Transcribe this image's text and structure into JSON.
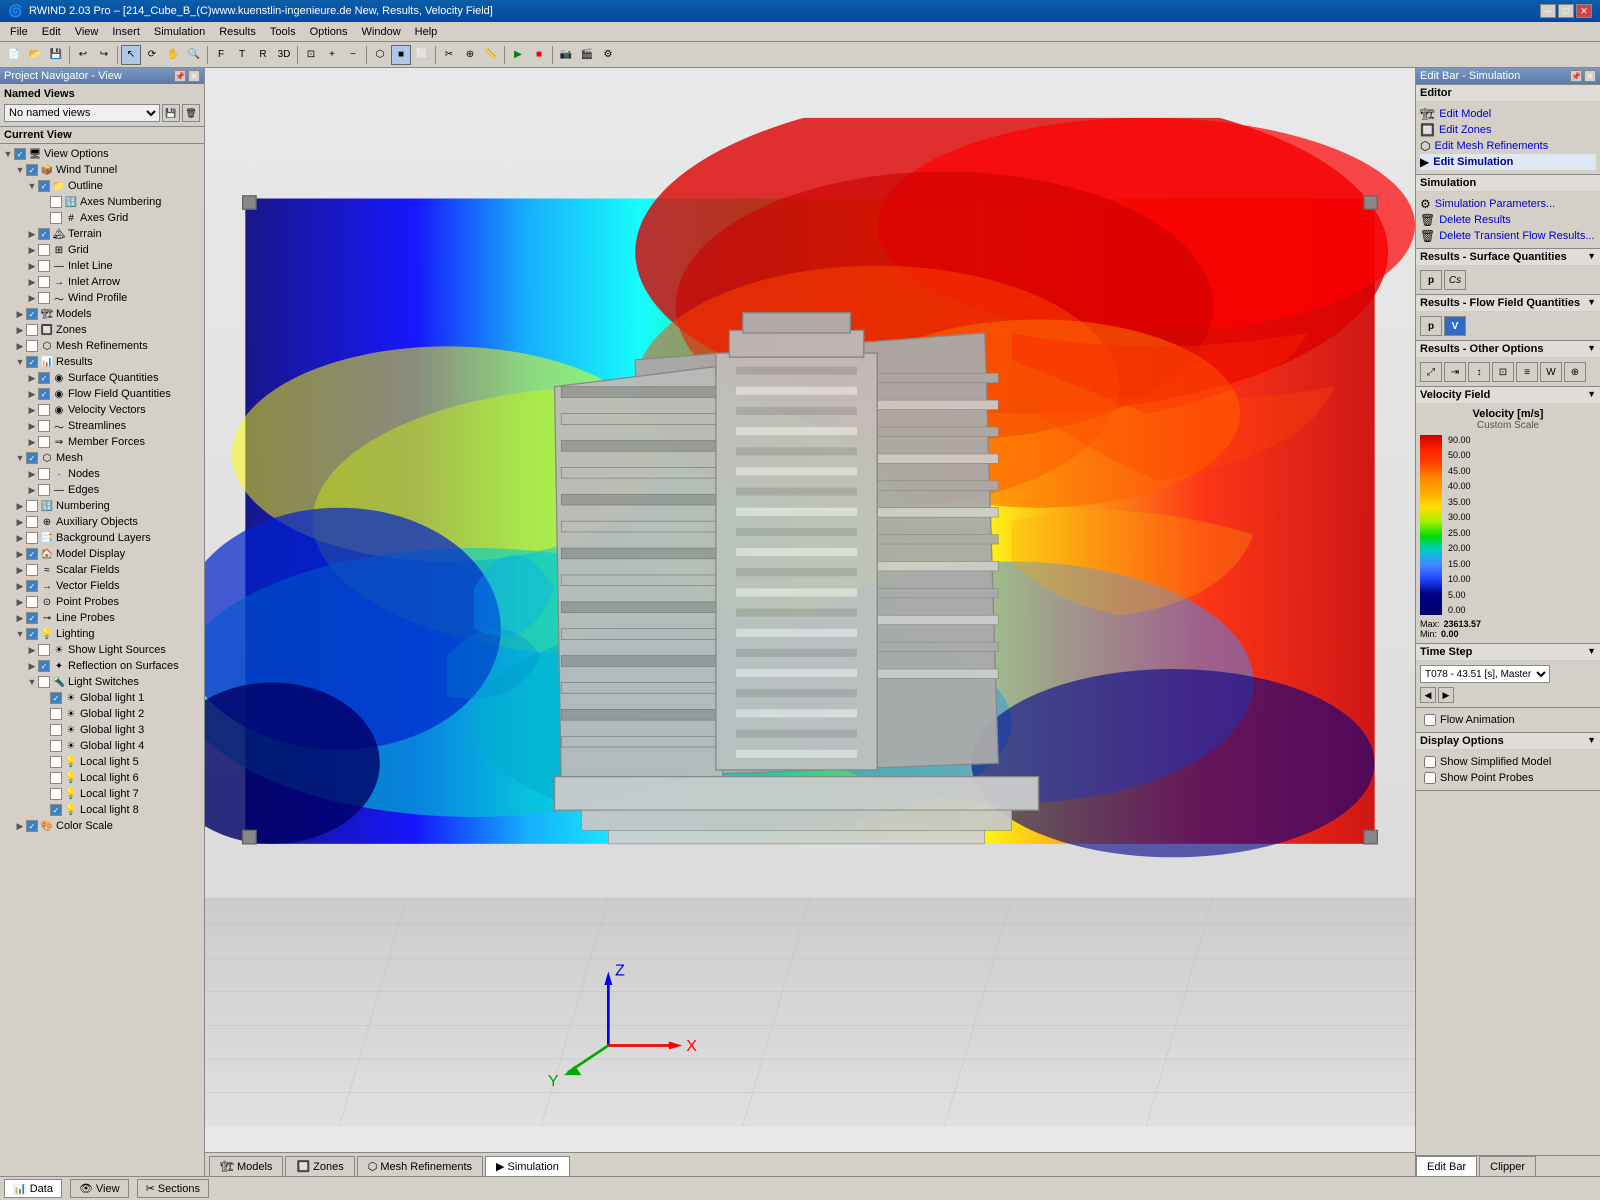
{
  "window": {
    "title": "RWIND 2.03 Pro – [214_Cube_B_(C)www.kuenstlin-ingenieure.de New, Results, Velocity Field]",
    "icon": "🌀"
  },
  "menu": {
    "items": [
      "File",
      "Edit",
      "View",
      "Insert",
      "Simulation",
      "Results",
      "Tools",
      "Options",
      "Window",
      "Help"
    ]
  },
  "left_panel": {
    "title": "Project Navigator - View",
    "named_views_label": "Named Views",
    "named_views_placeholder": "No named views",
    "current_view_label": "Current View",
    "tree": [
      {
        "id": "view-options",
        "label": "View Options",
        "level": 0,
        "expand": true,
        "checked": true,
        "icon": "🖥"
      },
      {
        "id": "wind-tunnel",
        "label": "Wind Tunnel",
        "level": 1,
        "expand": true,
        "checked": true,
        "icon": "📦"
      },
      {
        "id": "outline",
        "label": "Outline",
        "level": 2,
        "expand": true,
        "checked": true,
        "icon": "📁"
      },
      {
        "id": "axes-numbering",
        "label": "Axes Numbering",
        "level": 3,
        "checked": false,
        "icon": "🔢"
      },
      {
        "id": "axes-grid",
        "label": "Axes Grid",
        "level": 3,
        "checked": false,
        "icon": "#"
      },
      {
        "id": "terrain",
        "label": "Terrain",
        "level": 2,
        "checked": true,
        "icon": "🏔"
      },
      {
        "id": "grid",
        "label": "Grid",
        "level": 2,
        "checked": false,
        "icon": "⊞"
      },
      {
        "id": "inlet-line",
        "label": "Inlet Line",
        "level": 2,
        "checked": false,
        "icon": "—"
      },
      {
        "id": "inlet-arrow",
        "label": "Inlet Arrow",
        "level": 2,
        "checked": false,
        "icon": "→"
      },
      {
        "id": "wind-profile",
        "label": "Wind Profile",
        "level": 2,
        "checked": false,
        "icon": "〜"
      },
      {
        "id": "models",
        "label": "Models",
        "level": 1,
        "checked": true,
        "icon": "🏗"
      },
      {
        "id": "zones",
        "label": "Zones",
        "level": 1,
        "checked": false,
        "icon": "🔲"
      },
      {
        "id": "mesh-refinements",
        "label": "Mesh Refinements",
        "level": 1,
        "checked": false,
        "icon": "⬡"
      },
      {
        "id": "results",
        "label": "Results",
        "level": 1,
        "expand": true,
        "checked": true,
        "icon": "📊"
      },
      {
        "id": "surface-quantities",
        "label": "Surface Quantities",
        "level": 2,
        "checked": true,
        "icon": "◉"
      },
      {
        "id": "flow-field-quantities",
        "label": "Flow Field Quantities",
        "level": 2,
        "checked": true,
        "icon": "◉"
      },
      {
        "id": "velocity-vectors",
        "label": "Velocity Vectors",
        "level": 2,
        "checked": false,
        "icon": "◉"
      },
      {
        "id": "streamlines",
        "label": "Streamlines",
        "level": 2,
        "checked": false,
        "icon": "〜"
      },
      {
        "id": "member-forces",
        "label": "Member Forces",
        "level": 2,
        "checked": false,
        "icon": "⇒"
      },
      {
        "id": "mesh",
        "label": "Mesh",
        "level": 1,
        "expand": true,
        "checked": true,
        "icon": "⬡"
      },
      {
        "id": "nodes",
        "label": "Nodes",
        "level": 2,
        "checked": false,
        "icon": "·"
      },
      {
        "id": "edges",
        "label": "Edges",
        "level": 2,
        "checked": false,
        "icon": "—"
      },
      {
        "id": "numbering",
        "label": "Numbering",
        "level": 1,
        "checked": false,
        "icon": "🔢"
      },
      {
        "id": "auxiliary-objects",
        "label": "Auxiliary Objects",
        "level": 1,
        "checked": false,
        "icon": "⊕"
      },
      {
        "id": "background-layers",
        "label": "Background Layers",
        "level": 1,
        "checked": false,
        "icon": "📑"
      },
      {
        "id": "model-display",
        "label": "Model Display",
        "level": 1,
        "checked": true,
        "icon": "🏠"
      },
      {
        "id": "scalar-fields",
        "label": "Scalar Fields",
        "level": 1,
        "checked": false,
        "icon": "≈"
      },
      {
        "id": "vector-fields",
        "label": "Vector Fields",
        "level": 1,
        "checked": true,
        "icon": "→"
      },
      {
        "id": "point-probes",
        "label": "Point Probes",
        "level": 1,
        "checked": false,
        "icon": "⊙"
      },
      {
        "id": "line-probes",
        "label": "Line Probes",
        "level": 1,
        "checked": true,
        "icon": "⊸"
      },
      {
        "id": "lighting",
        "label": "Lighting",
        "level": 1,
        "expand": true,
        "checked": true,
        "icon": "💡"
      },
      {
        "id": "show-light-sources",
        "label": "Show Light Sources",
        "level": 2,
        "checked": false,
        "icon": "☀"
      },
      {
        "id": "reflection-on-surfaces",
        "label": "Reflection on Surfaces",
        "level": 2,
        "checked": true,
        "icon": "✦"
      },
      {
        "id": "light-switches",
        "label": "Light Switches",
        "level": 2,
        "expand": true,
        "checked": false,
        "icon": "🔦"
      },
      {
        "id": "global-light-1",
        "label": "Global light 1",
        "level": 3,
        "checked": true,
        "icon": "☀"
      },
      {
        "id": "global-light-2",
        "label": "Global light 2",
        "level": 3,
        "checked": false,
        "icon": "☀"
      },
      {
        "id": "global-light-3",
        "label": "Global light 3",
        "level": 3,
        "checked": false,
        "icon": "☀"
      },
      {
        "id": "global-light-4",
        "label": "Global light 4",
        "level": 3,
        "checked": false,
        "icon": "☀"
      },
      {
        "id": "local-light-5",
        "label": "Local light 5",
        "level": 3,
        "checked": false,
        "icon": "💡"
      },
      {
        "id": "local-light-6",
        "label": "Local light 6",
        "level": 3,
        "checked": false,
        "icon": "💡"
      },
      {
        "id": "local-light-7",
        "label": "Local light 7",
        "level": 3,
        "checked": false,
        "icon": "💡"
      },
      {
        "id": "local-light-8",
        "label": "Local light 8",
        "level": 3,
        "checked": true,
        "icon": "💡"
      },
      {
        "id": "color-scale",
        "label": "Color Scale",
        "level": 1,
        "checked": true,
        "icon": "🎨"
      }
    ]
  },
  "right_panel": {
    "title": "Edit Bar - Simulation",
    "editor_section": "Editor",
    "editor_items": [
      "Edit Model",
      "Edit Zones",
      "Edit Mesh Refinements",
      "Edit Simulation"
    ],
    "simulation_section": "Simulation",
    "simulation_items": [
      "Simulation Parameters...",
      "Delete Results",
      "Delete Transient Flow Results..."
    ],
    "results_surface_section": "Results - Surface Quantities",
    "results_flow_section": "Results - Flow Field Quantities",
    "results_other_section": "Results - Other Options",
    "velocity_field_section": "Velocity Field",
    "velocity_scale_title": "Velocity [m/s]",
    "velocity_scale_subtitle": "Custom Scale",
    "color_scale": [
      {
        "value": "90.00",
        "color": "#cc0000"
      },
      {
        "value": "50.00",
        "color": "#ff4400"
      },
      {
        "value": "45.00",
        "color": "#ff6600"
      },
      {
        "value": "40.00",
        "color": "#ff8800"
      },
      {
        "value": "35.00",
        "color": "#ffaa00"
      },
      {
        "value": "30.00",
        "color": "#ffdd00"
      },
      {
        "value": "25.00",
        "color": "#aaee00"
      },
      {
        "value": "20.00",
        "color": "#00dd00"
      },
      {
        "value": "15.00",
        "color": "#00cccc"
      },
      {
        "value": "10.00",
        "color": "#6688ff"
      },
      {
        "value": "5.00",
        "color": "#4444ff"
      },
      {
        "value": "0.00",
        "color": "#000066"
      }
    ],
    "max_label": "Max:",
    "max_value": "23613.57",
    "min_label": "Min:",
    "min_value": "0.00",
    "time_step_section": "Time Step",
    "time_step_value": "T078 - 43.51 [s], Master",
    "flow_animation_label": "Flow Animation",
    "display_options_section": "Display Options",
    "show_simplified_model": "Show Simplified Model",
    "show_point_probes": "Show Point Probes"
  },
  "bottom_status": {
    "tabs": [
      "Data",
      "View",
      "Sections"
    ],
    "viewport_tabs": [
      "Models",
      "Zones",
      "Mesh Refinements",
      "Simulation"
    ],
    "active_viewport_tab": "Simulation",
    "right_tabs": [
      "Edit Bar",
      "Clipper"
    ]
  },
  "viewport": {
    "axes": {
      "x": "X",
      "y": "Y",
      "z": "Z"
    }
  }
}
